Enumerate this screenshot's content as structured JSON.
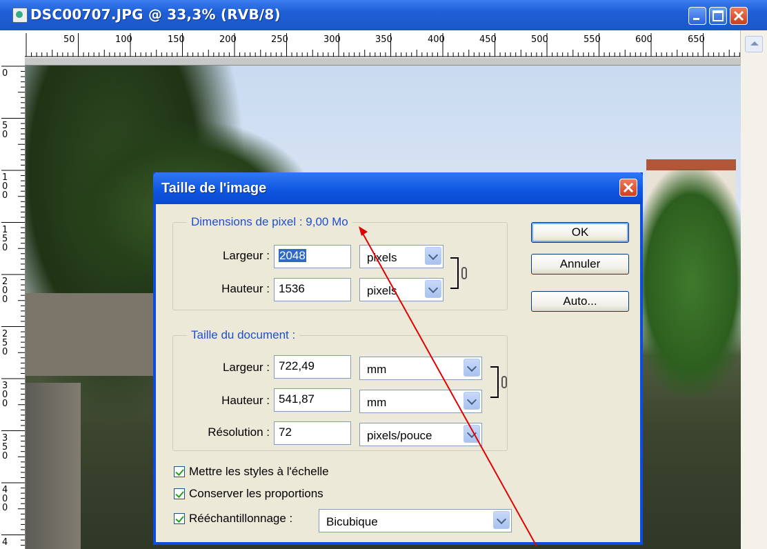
{
  "window": {
    "title": "DSC00707.JPG @ 33,3% (RVB/8)"
  },
  "ruler": {
    "top": [
      "50",
      "100",
      "150",
      "200",
      "250",
      "300",
      "350",
      "400",
      "450",
      "500",
      "550",
      "600",
      "650"
    ],
    "left": [
      [
        "0"
      ],
      [
        "5",
        "0"
      ],
      [
        "1",
        "0",
        "0"
      ],
      [
        "1",
        "5",
        "0"
      ],
      [
        "2",
        "0",
        "0"
      ],
      [
        "2",
        "5",
        "0"
      ],
      [
        "3",
        "0",
        "0"
      ],
      [
        "3",
        "5",
        "0"
      ],
      [
        "4",
        "0",
        "0"
      ],
      [
        "4"
      ]
    ]
  },
  "dialog": {
    "title": "Taille de l'image",
    "pixel_group": {
      "title": "Dimensions de pixel :  9,00 Mo",
      "width_label": "Largeur :",
      "width_value": "2048",
      "width_unit": "pixels",
      "height_label": "Hauteur :",
      "height_value": "1536",
      "height_unit": "pixels"
    },
    "doc_group": {
      "title": "Taille du document :",
      "width_label": "Largeur :",
      "width_value": "722,49",
      "width_unit": "mm",
      "height_label": "Hauteur :",
      "height_value": "541,87",
      "height_unit": "mm",
      "res_label": "Résolution :",
      "res_value": "72",
      "res_unit": "pixels/pouce"
    },
    "buttons": {
      "ok": "OK",
      "cancel": "Annuler",
      "auto": "Auto..."
    },
    "checkboxes": {
      "scale_styles": "Mettre les styles à l'échelle",
      "constrain": "Conserver les proportions",
      "resample": "Rééchantillonnage :"
    },
    "resample_method": "Bicubique"
  },
  "colors": {
    "title_bar": "#1f5fd6",
    "dialog_bg": "#ece9d8",
    "group_title": "#1e4fd0",
    "annotation": "#e00000"
  }
}
